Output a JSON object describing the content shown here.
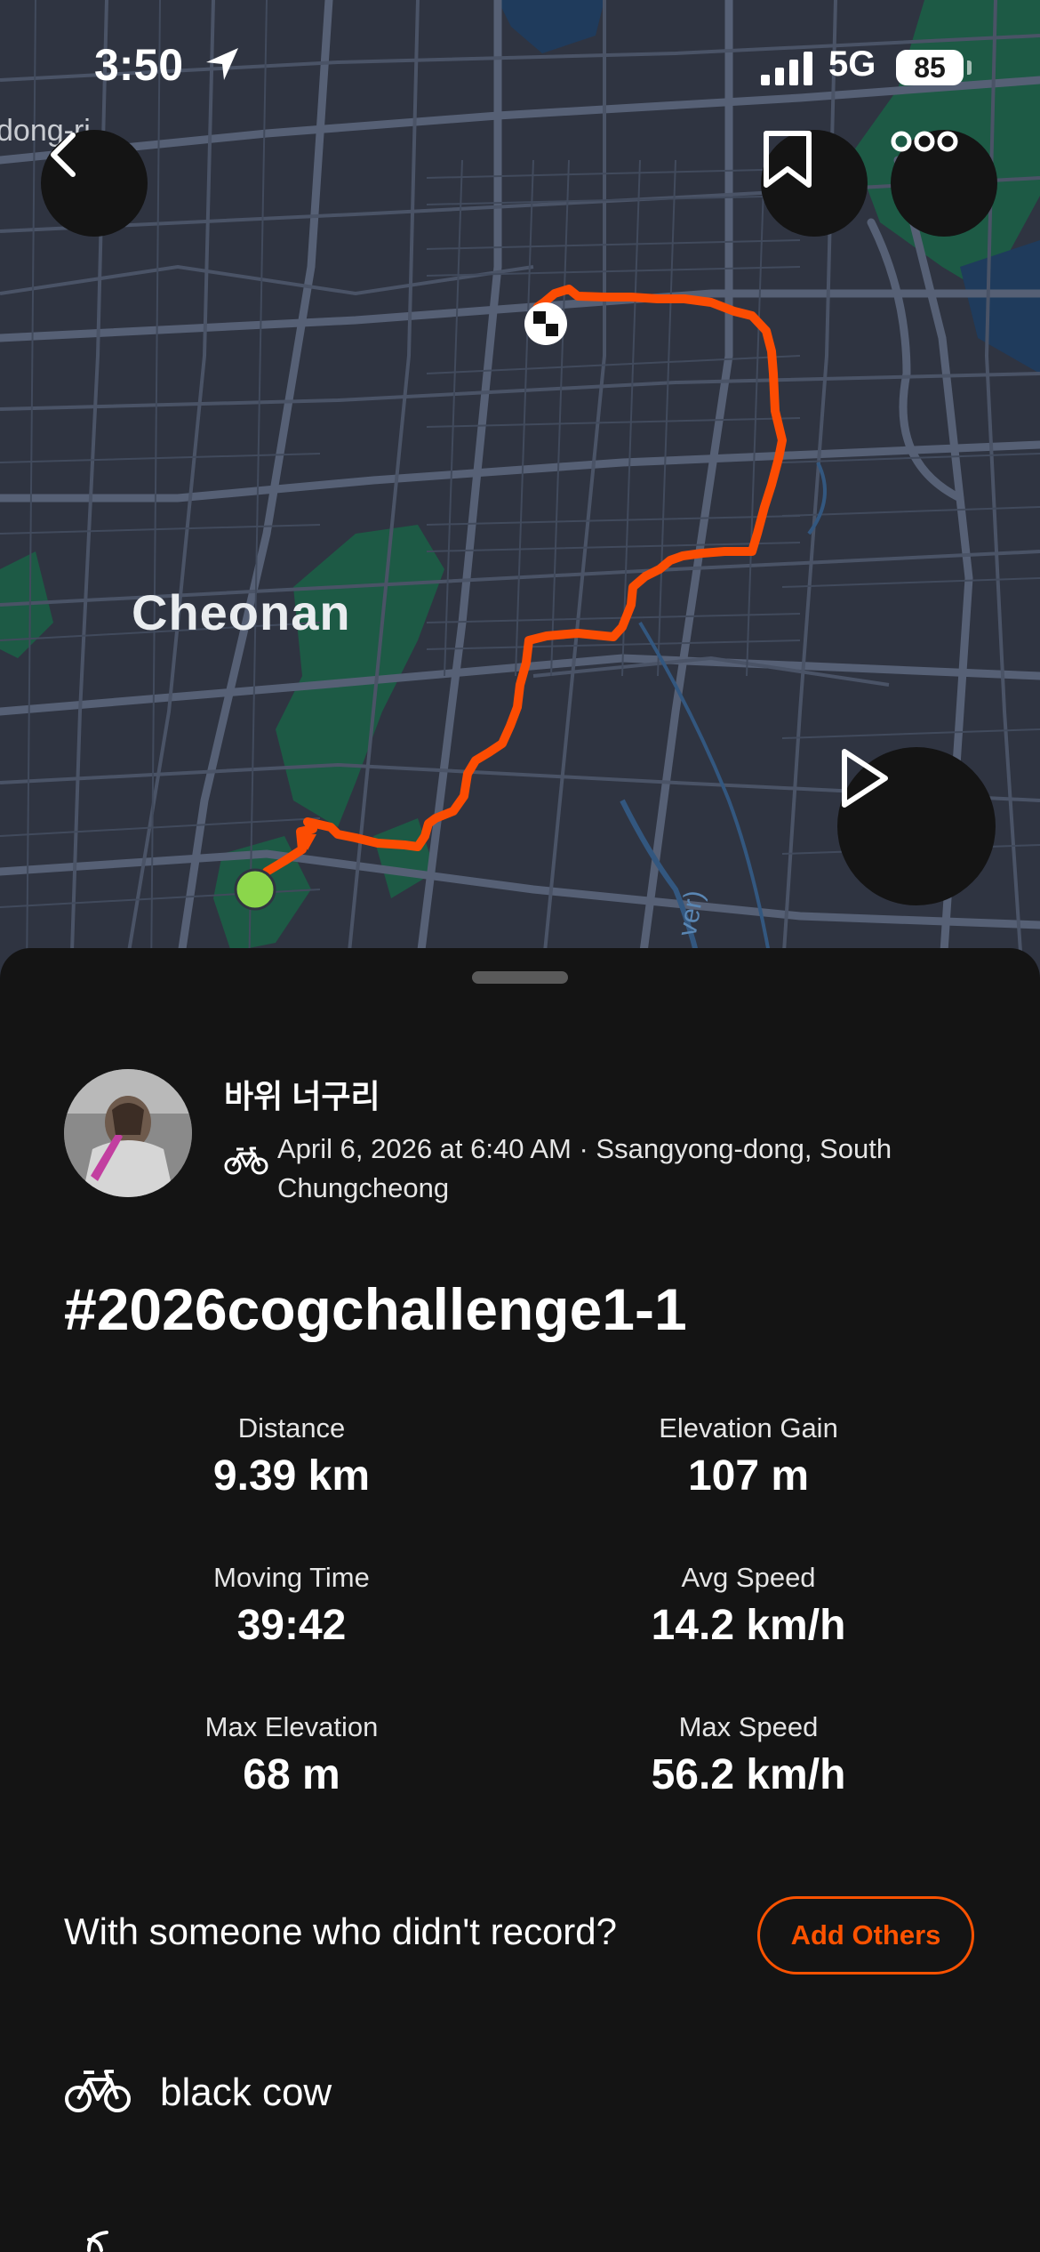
{
  "status_bar": {
    "time": "3:50",
    "network": "5G",
    "battery": "85"
  },
  "map": {
    "city_label": "Cheonan",
    "partial_label": "dong-ri",
    "river_label": "ver)",
    "route_color": "#fc4c02",
    "start_marker_color": "#8bd64b"
  },
  "actions": {
    "back_icon": "chevron-left-icon",
    "bookmark_icon": "bookmark-icon",
    "more_icon": "more-horizontal-icon",
    "play_icon": "play-icon"
  },
  "activity": {
    "athlete_name": "바위 너구리",
    "meta": "April 6, 2026 at 6:40 AM · Ssangyong-dong, South Chungcheong",
    "title": "#2026cogchallenge1-1",
    "stats": [
      {
        "label": "Distance",
        "value": "9.39 km"
      },
      {
        "label": "Elevation Gain",
        "value": "107 m"
      },
      {
        "label": "Moving Time",
        "value": "39:42"
      },
      {
        "label": "Avg Speed",
        "value": "14.2 km/h"
      },
      {
        "label": "Max Elevation",
        "value": "68 m"
      },
      {
        "label": "Max Speed",
        "value": "56.2 km/h"
      }
    ],
    "with_someone_text": "With someone who didn't record?",
    "add_others_label": "Add Others",
    "gear_name": "black cow"
  },
  "colors": {
    "accent": "#fc5200",
    "background": "#141414",
    "map_background": "#2f3441"
  }
}
